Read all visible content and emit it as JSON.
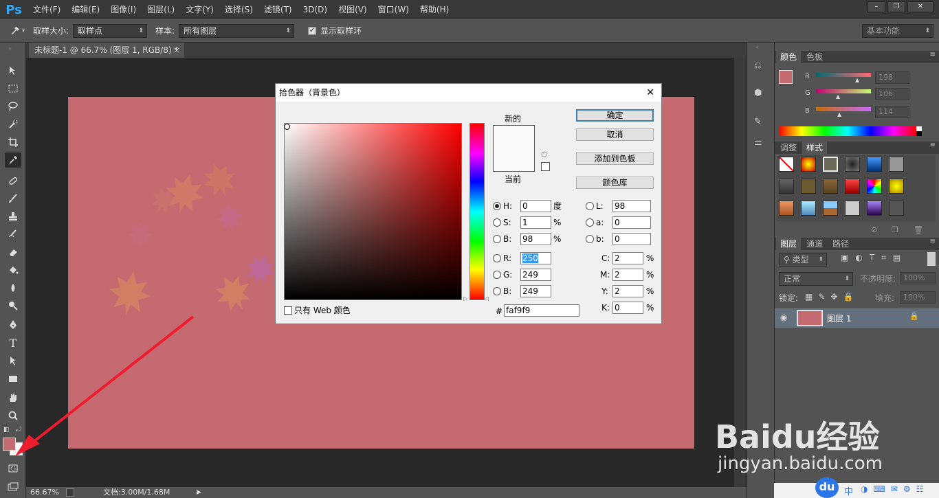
{
  "app": {
    "logo": "Ps"
  },
  "menu": [
    "文件(F)",
    "编辑(E)",
    "图像(I)",
    "图层(L)",
    "文字(Y)",
    "选择(S)",
    "滤镜(T)",
    "3D(D)",
    "视图(V)",
    "窗口(W)",
    "帮助(H)"
  ],
  "window_buttons": [
    "–",
    "❐",
    "✕"
  ],
  "options": {
    "sample_size_label": "取样大小:",
    "sample_size_value": "取样点",
    "sample_label": "样本:",
    "sample_value": "所有图层",
    "show_ring_label": "显示取样环",
    "show_ring_checked": true,
    "workspace_value": "基本功能"
  },
  "document": {
    "tab_title": "未标题-1 @ 66.7% (图层 1, RGB/8) *",
    "close": "×"
  },
  "status": {
    "zoom": "66.67%",
    "doc_info": "文档:3.00M/1.68M"
  },
  "colors": {
    "foreground": "#c66a72",
    "background": "#faf9f9",
    "canvas": "#c66a72"
  },
  "picker": {
    "title": "拾色器（背景色）",
    "close": "✕",
    "new_label": "新的",
    "current_label": "当前",
    "ok": "确定",
    "cancel": "取消",
    "add_swatch": "添加到色板",
    "color_lib": "颜色库",
    "web_only": "只有 Web 颜色",
    "hsb": {
      "H": "0",
      "S": "1",
      "B": "98"
    },
    "rgb": {
      "R": "250",
      "G": "249",
      "B": "249"
    },
    "lab": {
      "L": "98",
      "a": "0",
      "b": "0"
    },
    "cmyk": {
      "C": "2",
      "M": "2",
      "Y": "2",
      "K": "0"
    },
    "hex": "faf9f9",
    "hue_unit": "度",
    "pct": "%"
  },
  "color_panel": {
    "tabs": [
      "颜色",
      "色板"
    ],
    "labels": [
      "R",
      "G",
      "B"
    ],
    "values": [
      "198",
      "106",
      "114"
    ]
  },
  "styles_panel": {
    "tabs": [
      "调整",
      "样式"
    ]
  },
  "layers_panel": {
    "tabs": [
      "图层",
      "通道",
      "路径"
    ],
    "filter_label": "类型",
    "blend_mode": "正常",
    "opacity_label": "不透明度:",
    "opacity_value": "100%",
    "lock_label": "锁定:",
    "fill_label": "填充:",
    "fill_value": "100%",
    "layer_name": "图层 1"
  },
  "watermark": {
    "brand": "Baidu经验",
    "url": "jingyan.baidu.com",
    "du": "du",
    "bottom_text": "中"
  }
}
